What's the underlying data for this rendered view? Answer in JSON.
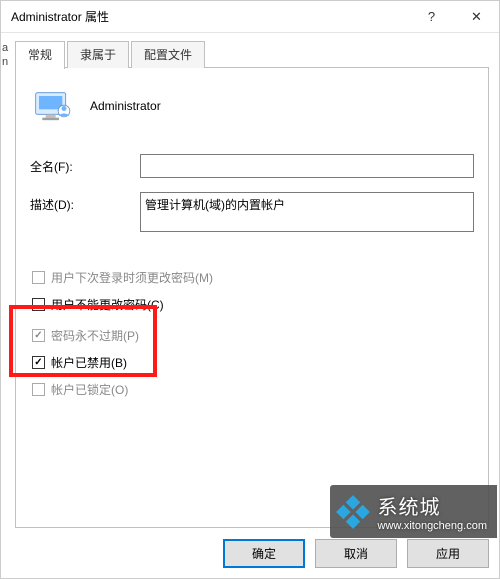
{
  "window": {
    "title": "Administrator 属性",
    "help_icon": "?",
    "close_icon": "✕"
  },
  "tabs": {
    "general": "常规",
    "memberof": "隶属于",
    "profile": "配置文件"
  },
  "identity": {
    "display_name": "Administrator"
  },
  "fields": {
    "fullname_label": "全名(F):",
    "fullname_value": "",
    "description_label": "描述(D):",
    "description_value": "管理计算机(域)的内置帐户"
  },
  "checks": {
    "must_change": "用户下次登录时须更改密码(M)",
    "cannot_change": "用户不能更改密码(C)",
    "never_expire": "密码永不过期(P)",
    "disabled": "帐户已禁用(B)",
    "locked": "帐户已锁定(O)"
  },
  "buttons": {
    "ok": "确定",
    "cancel": "取消",
    "apply": "应用"
  },
  "watermark": {
    "brand": "系统城",
    "url": "www.xitongcheng.com"
  },
  "left_hint": "a\nn"
}
